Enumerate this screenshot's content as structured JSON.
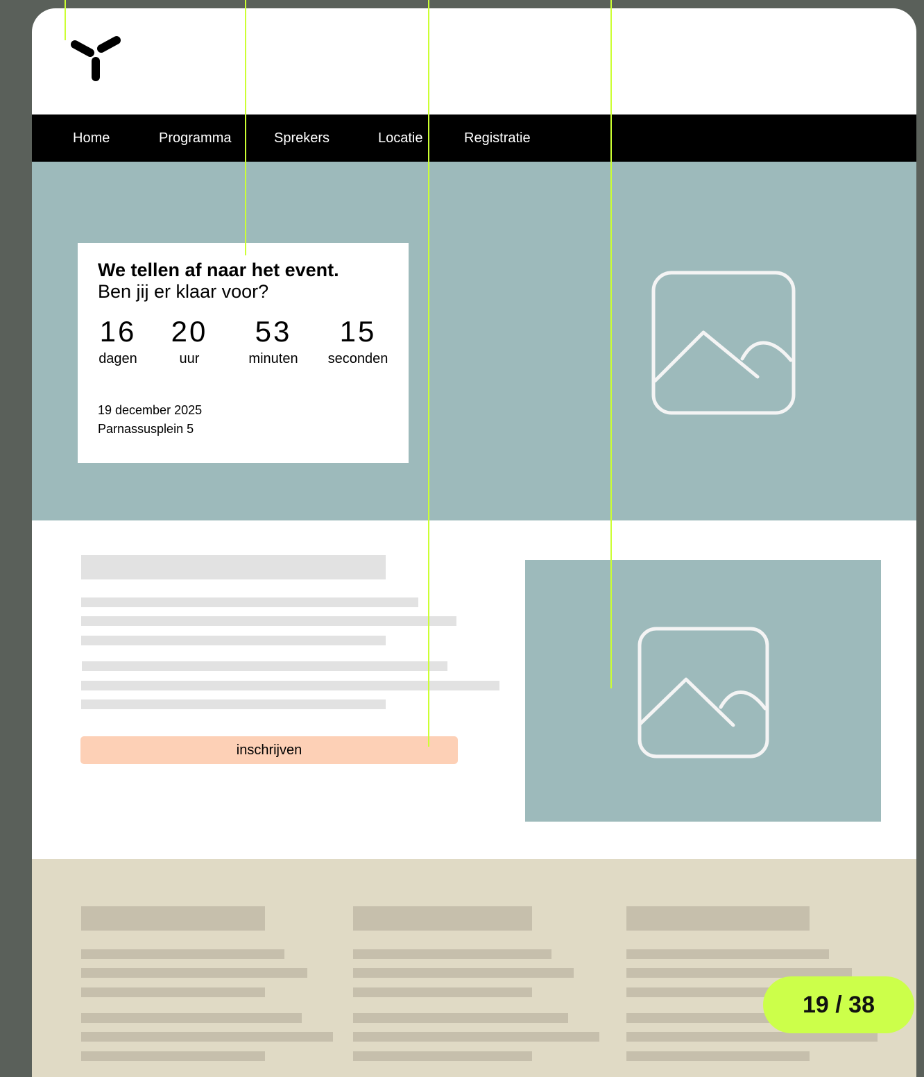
{
  "nav": {
    "items": [
      {
        "label": "Home"
      },
      {
        "label": "Programma"
      },
      {
        "label": "Sprekers"
      },
      {
        "label": "Locatie"
      },
      {
        "label": "Registratie"
      }
    ]
  },
  "countdown": {
    "heading": "We tellen af naar het event.",
    "subheading": "Ben jij er klaar voor?",
    "units": [
      {
        "value": "16",
        "label": "dagen"
      },
      {
        "value": "20",
        "label": "uur"
      },
      {
        "value": "53",
        "label": "minuten"
      },
      {
        "value": "15",
        "label": "seconden"
      }
    ],
    "date": "19 december 2025",
    "address": "Parnassusplein 5"
  },
  "cta": {
    "label": "inschrijven"
  },
  "pager": {
    "text": "19 / 38"
  },
  "icons": {
    "logo": "logo-y-icon",
    "image": "image-placeholder-icon"
  },
  "colors": {
    "background": "#5a605a",
    "nav": "#000000",
    "hero": "#9dbabb",
    "cta": "#fdd0b6",
    "footer": "#e0dac5",
    "highlight": "#ccff33"
  }
}
